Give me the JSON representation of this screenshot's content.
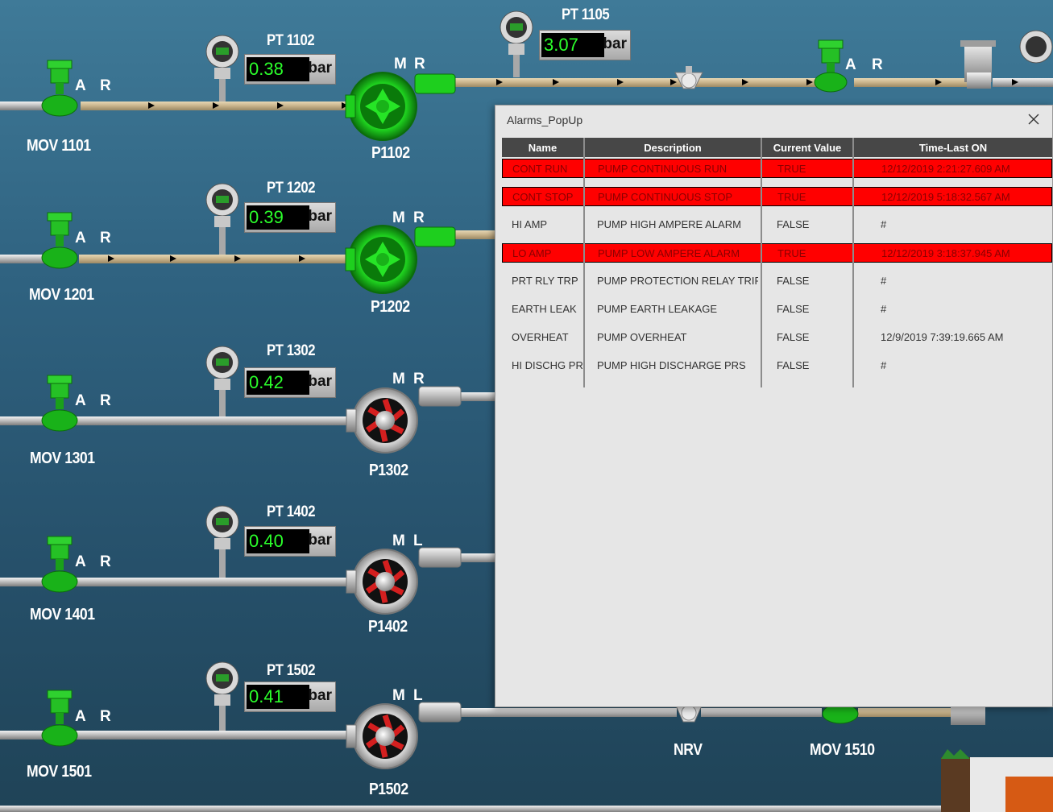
{
  "labels": {
    "mov1101": "MOV 1101",
    "mov1201": "MOV 1201",
    "mov1301": "MOV 1301",
    "mov1401": "MOV 1401",
    "mov1501": "MOV 1501",
    "p1102": "P1102",
    "p1202": "P1202",
    "p1302": "P1302",
    "p1402": "P1402",
    "p1502": "P1502",
    "nrv": "NRV",
    "mov1510": "MOV 1510"
  },
  "mode_letters": {
    "a": "A",
    "r": "R",
    "m": "M",
    "l": "L"
  },
  "pressure_transmitters": [
    {
      "tag": "PT 1102",
      "value": "0.38",
      "unit": "bar"
    },
    {
      "tag": "PT 1202",
      "value": "0.39",
      "unit": "bar"
    },
    {
      "tag": "PT 1302",
      "value": "0.42",
      "unit": "bar"
    },
    {
      "tag": "PT 1402",
      "value": "0.40",
      "unit": "bar"
    },
    {
      "tag": "PT 1502",
      "value": "0.41",
      "unit": "bar"
    },
    {
      "tag": "PT 1105",
      "value": "3.07",
      "unit": "bar"
    }
  ],
  "colors": {
    "running": "#1fd81f",
    "stopped": "#d41f1f",
    "alarm_row": "#ff0000",
    "flow_pipe": "#c9b48f"
  },
  "popup": {
    "title": "Alarms_PopUp",
    "columns": [
      "Name",
      "Description",
      "Current Value",
      "Time-Last ON"
    ],
    "rows": [
      {
        "name": "CONT RUN",
        "description": "PUMP CONTINUOUS RUN",
        "value": "TRUE",
        "time": "12/12/2019 2:21:27.609 AM",
        "alarm": true
      },
      {
        "name": "CONT STOP",
        "description": "PUMP CONTINUOUS STOP",
        "value": "TRUE",
        "time": "12/12/2019 5:18:32.567 AM",
        "alarm": true
      },
      {
        "name": "HI AMP",
        "description": "PUMP HIGH AMPERE ALARM",
        "value": "FALSE",
        "time": "#",
        "alarm": false
      },
      {
        "name": "LO AMP",
        "description": "PUMP LOW AMPERE ALARM",
        "value": "TRUE",
        "time": "12/12/2019 3:18:37.945 AM",
        "alarm": true
      },
      {
        "name": "PRT RLY TRP",
        "description": "PUMP PROTECTION RELAY TRIP",
        "value": "FALSE",
        "time": "#",
        "alarm": false
      },
      {
        "name": "EARTH LEAK",
        "description": "PUMP EARTH LEAKAGE",
        "value": "FALSE",
        "time": "#",
        "alarm": false
      },
      {
        "name": "OVERHEAT",
        "description": "PUMP OVERHEAT",
        "value": "FALSE",
        "time": "12/9/2019 7:39:19.665 AM",
        "alarm": false
      },
      {
        "name": "HI DISCHG PR",
        "description": "PUMP HIGH DISCHARGE PRS",
        "value": "FALSE",
        "time": "#",
        "alarm": false
      }
    ]
  }
}
